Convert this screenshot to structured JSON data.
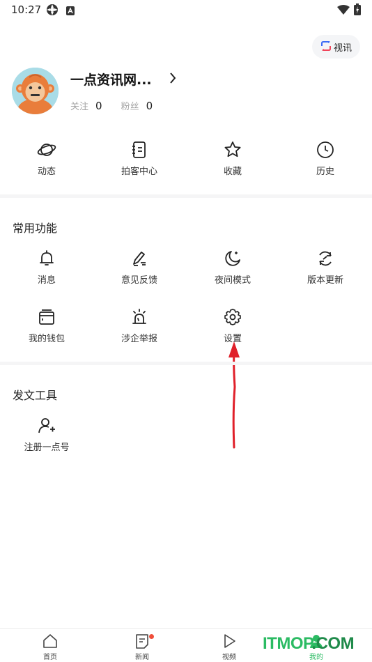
{
  "status_bar": {
    "time": "10:27"
  },
  "header": {
    "video_chat_label": "视讯"
  },
  "profile": {
    "username": "一点资讯网...",
    "following_label": "关注",
    "following_count": "0",
    "fans_label": "粉丝",
    "fans_count": "0"
  },
  "quick_actions": [
    {
      "label": "动态",
      "icon": "planet-icon"
    },
    {
      "label": "拍客中心",
      "icon": "notebook-icon"
    },
    {
      "label": "收藏",
      "icon": "star-icon"
    },
    {
      "label": "历史",
      "icon": "clock-icon"
    }
  ],
  "common_functions": {
    "title": "常用功能",
    "items": [
      {
        "label": "消息",
        "icon": "bell-icon"
      },
      {
        "label": "意见反馈",
        "icon": "pencil-icon"
      },
      {
        "label": "夜间模式",
        "icon": "moon-icon"
      },
      {
        "label": "版本更新",
        "icon": "refresh-icon"
      },
      {
        "label": "我的钱包",
        "icon": "wallet-icon"
      },
      {
        "label": "涉企举报",
        "icon": "alarm-icon"
      },
      {
        "label": "设置",
        "icon": "gear-icon"
      }
    ]
  },
  "publish_tools": {
    "title": "发文工具",
    "items": [
      {
        "label": "注册一点号",
        "icon": "add-user-icon"
      }
    ]
  },
  "bottom_nav": [
    {
      "label": "首页",
      "icon": "home-icon"
    },
    {
      "label": "新闻",
      "icon": "news-icon"
    },
    {
      "label": "视频",
      "icon": "play-icon"
    },
    {
      "label": "我的",
      "icon": "profile-icon"
    }
  ],
  "watermark": {
    "text_main": "ITMOP",
    "text_suffix": ".COM"
  },
  "colors": {
    "accent_green": "#2bbb63",
    "arrow_red": "#e0202a",
    "badge_red": "#f04e3a",
    "avatar_bg": "#a9dce7",
    "monkey_orange": "#e97d3b"
  }
}
